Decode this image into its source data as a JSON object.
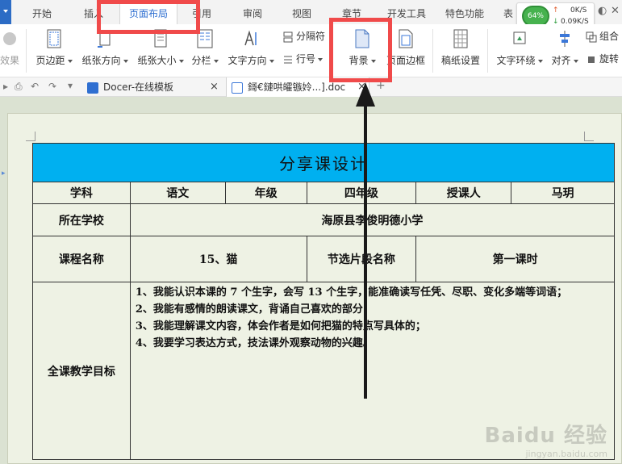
{
  "tabs": [
    "开始",
    "插入",
    "页面布局",
    "引用",
    "审阅",
    "视图",
    "章节",
    "开发工具",
    "特色功能",
    "表"
  ],
  "network": {
    "percent": "64%",
    "upload": "0K/S",
    "download": "0.09K/S"
  },
  "ribbon": {
    "effects": "效果",
    "margins": "页边距",
    "orientation": "纸张方向",
    "size": "纸张大小",
    "columns": "分栏",
    "text_direction": "文字方向",
    "breaks": "分隔符",
    "line_numbers": "行号",
    "background": "背景",
    "page_border": "页面边框",
    "grid_paper": "稿纸设置",
    "wrap_text": "文字环绕",
    "align": "对齐",
    "group": "组合",
    "rotate": "旋转"
  },
  "doc_tabs": [
    {
      "title": "Docer-在线模板",
      "close": "×"
    },
    {
      "title": "鎶€鏈哄皬镞姈...].doc",
      "close": "×"
    }
  ],
  "lesson": {
    "title": "分享课设计",
    "subject_label": "学科",
    "subject": "语文",
    "grade_label": "年级",
    "grade": "四年级",
    "teacher_label": "授课人",
    "teacher": "马玥",
    "school_label": "所在学校",
    "school": "海原县李俊明德小学",
    "course_label": "课程名称",
    "course": "15、猫",
    "section_label": "节选片段名称",
    "section": "第一课时",
    "goals_label": "全课教学目标",
    "goals": [
      "1、我能认识本课的 7 个生字，会写 13 个生字，能准确读写任凭、尽职、变化多端等词语；",
      "2、我能有感情的朗读课文，背诵自己喜欢的部分；",
      "3、我能理解课文内容，体会作者是如何把猫的特点写具体的；",
      "4、我要学习表达方式，技法课外观察动物的兴趣。"
    ]
  },
  "watermark": {
    "brand": "Baidu 经验",
    "url": "jingyan.baidu.com"
  },
  "colors": {
    "accent": "#2f6fd1",
    "title_fill": "#00b0f0",
    "highlight": "#f04a4a",
    "page": "#eef2e4"
  }
}
